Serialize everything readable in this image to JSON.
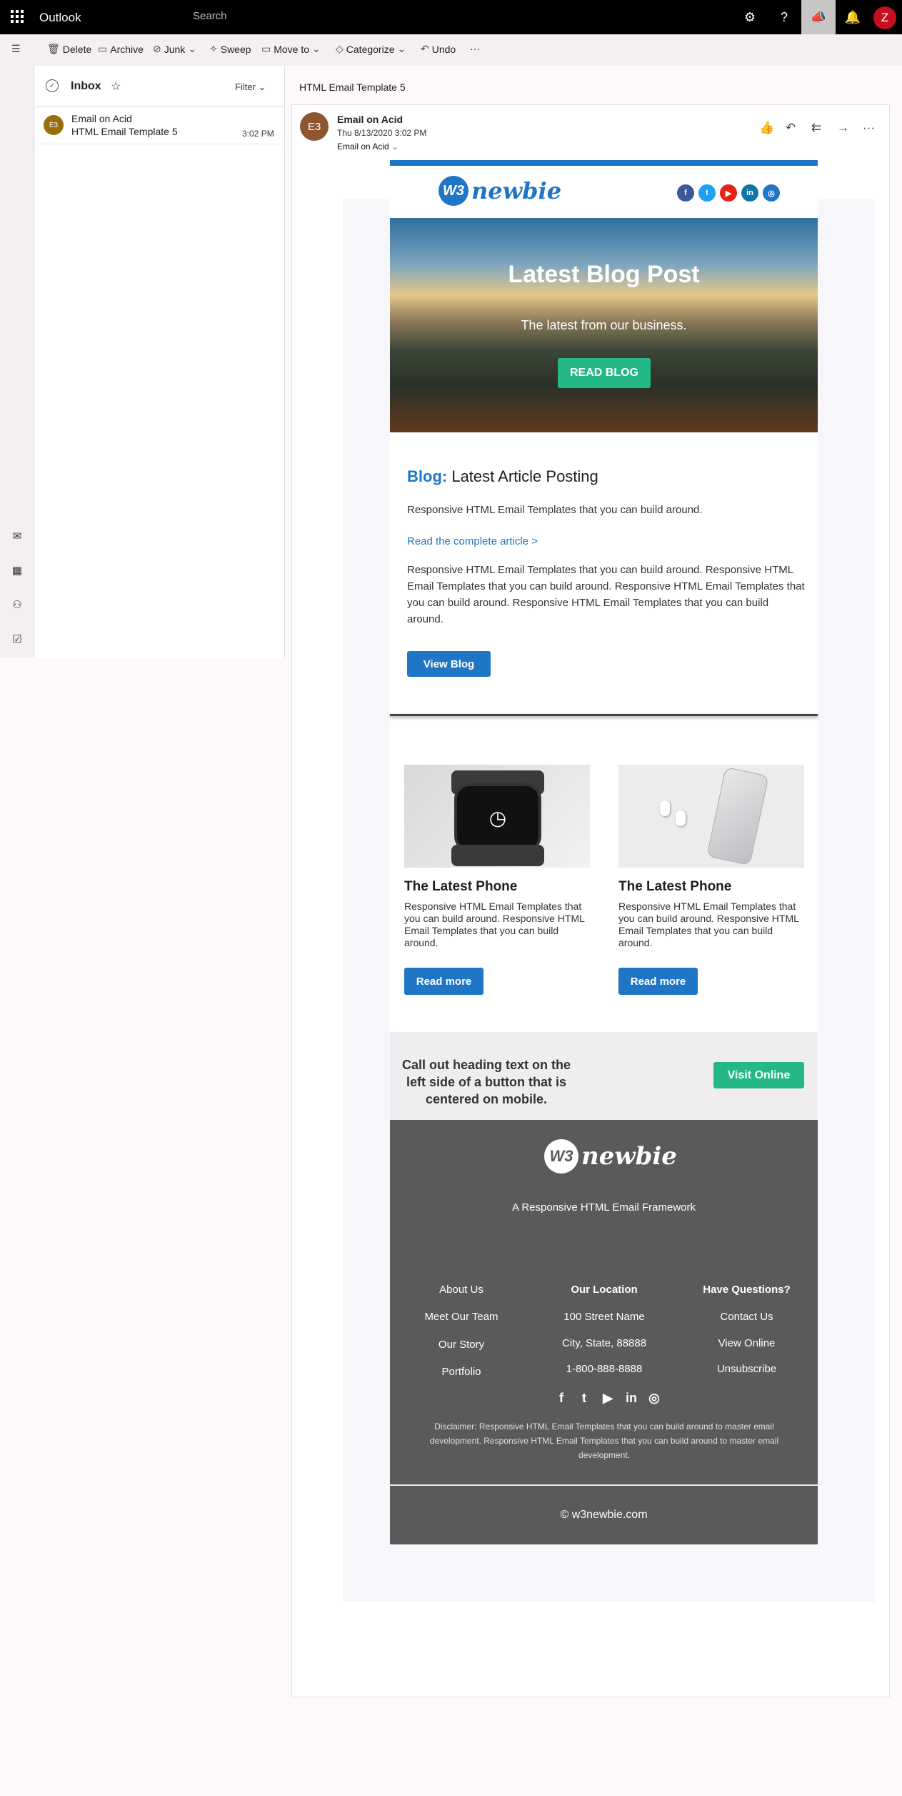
{
  "topbar": {
    "app_name": "Outlook",
    "search_placeholder": "Search",
    "avatar_initial": "Z"
  },
  "commands": {
    "delete": "Delete",
    "archive": "Archive",
    "junk": "Junk",
    "sweep": "Sweep",
    "move_to": "Move to",
    "categorize": "Categorize",
    "undo": "Undo",
    "more": "···"
  },
  "list": {
    "folder": "Inbox",
    "filter": "Filter",
    "messages": [
      {
        "initials": "E3",
        "sender": "Email on Acid",
        "subject": "HTML Email Template 5",
        "time": "3:02 PM"
      }
    ]
  },
  "reading": {
    "subject": "HTML Email Template 5",
    "sender_initials": "E3",
    "sender": "Email on Acid",
    "date": "Thu 8/13/2020 3:02 PM",
    "to": "Email on Acid"
  },
  "email": {
    "logo_w3": "W3",
    "logo_text": "newbie",
    "socials": [
      "f",
      "t",
      "▶",
      "in",
      "◎"
    ],
    "hero_title": "Latest Blog Post",
    "hero_subtitle": "The latest from our business.",
    "hero_button": "READ BLOG",
    "blog_label": "Blog:",
    "blog_heading": "Latest Article Posting",
    "blog_intro": "Responsive HTML Email Templates that you can build around.",
    "blog_link": "Read the complete article >",
    "blog_body": "Responsive HTML Email Templates that you can build around. Responsive HTML Email Templates that you can build around. Responsive HTML Email Templates that you can build around. Responsive HTML Email Templates that you can build around.",
    "blog_button": "View Blog",
    "products": [
      {
        "title": "The Latest Phone",
        "text": "Responsive HTML Email Templates that you can build around. Responsive HTML Email Templates that you can build around.",
        "button": "Read more"
      },
      {
        "title": "The Latest Phone",
        "text": "Responsive HTML Email Templates that you can build around. Responsive HTML Email Templates that you can build around.",
        "button": "Read more"
      }
    ],
    "callout_text": "Call out heading text on the left side of a button that is centered on mobile.",
    "callout_button": "Visit Online",
    "footer_tagline": "A Responsive HTML Email Framework",
    "footer_socials": [
      "f",
      "t",
      "▶",
      "in",
      "◎"
    ],
    "col1": {
      "items": [
        "About Us",
        "Meet Our Team",
        "Our Story",
        "Portfolio"
      ]
    },
    "col2": {
      "heading": "Our Location",
      "items": [
        "100 Street Name",
        "City, State, 88888",
        "1-800-888-8888"
      ]
    },
    "col3": {
      "heading": "Have Questions?",
      "items": [
        "Contact Us",
        "View Online",
        "Unsubscribe"
      ]
    },
    "disclaimer": "Disclaimer: Responsive HTML Email Templates that you can build around to master email development. Responsive HTML Email Templates that you can build around to master email development.",
    "copyright": "© w3newbie.com"
  },
  "colors": {
    "brand_blue": "#1f76c6",
    "green": "#25b887",
    "footer_gray": "#5a5a5a",
    "callout_bg": "#efedf0"
  }
}
